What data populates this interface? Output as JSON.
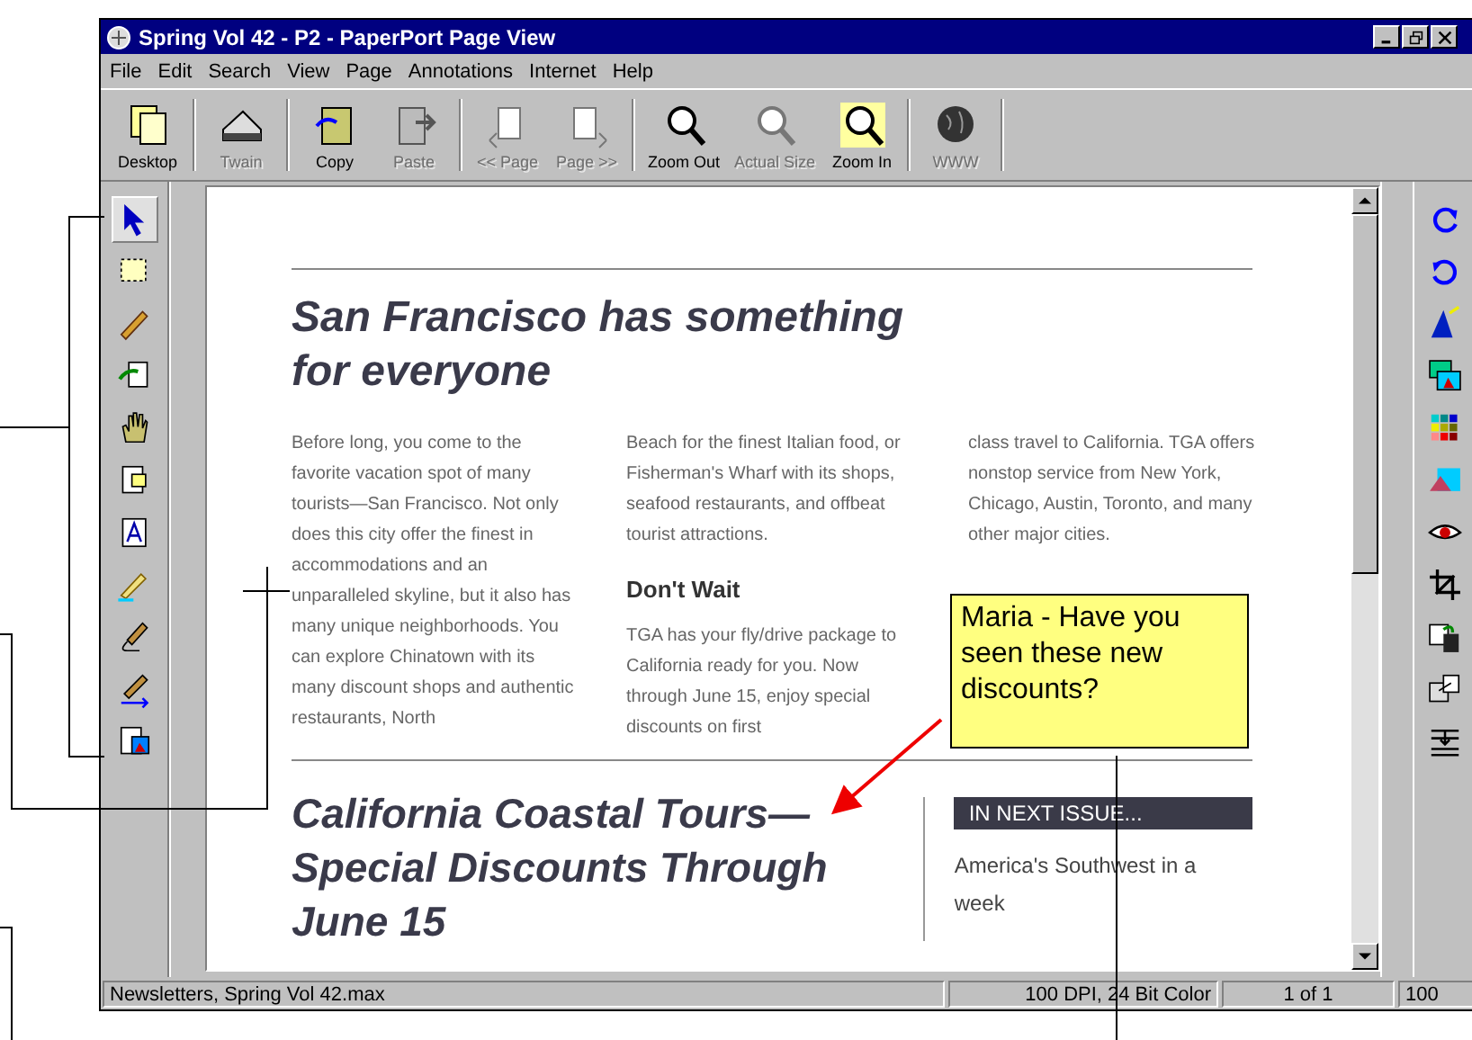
{
  "window": {
    "title": "Spring Vol 42 - P2 - PaperPort Page View"
  },
  "menu": [
    "File",
    "Edit",
    "Search",
    "View",
    "Page",
    "Annotations",
    "Internet",
    "Help"
  ],
  "toolbar": [
    [
      {
        "label": "Desktop",
        "disabled": false
      }
    ],
    [
      {
        "label": "Twain",
        "disabled": true
      }
    ],
    [
      {
        "label": "Copy",
        "disabled": false
      },
      {
        "label": "Paste",
        "disabled": true
      }
    ],
    [
      {
        "label": "<< Page",
        "disabled": true
      },
      {
        "label": "Page >>",
        "disabled": true
      }
    ],
    [
      {
        "label": "Zoom Out",
        "disabled": false
      },
      {
        "label": "Actual Size",
        "disabled": true
      },
      {
        "label": "Zoom In",
        "disabled": false
      }
    ],
    [
      {
        "label": "WWW",
        "disabled": true
      }
    ]
  ],
  "left_tools": [
    {
      "selected": true
    },
    {
      "selected": false
    },
    {
      "selected": false
    },
    {
      "selected": false
    },
    {
      "selected": false
    },
    {
      "selected": false
    },
    {
      "selected": false
    },
    {
      "selected": false
    },
    {
      "selected": false
    },
    {
      "selected": false
    },
    {
      "selected": false
    }
  ],
  "document": {
    "heading": "San Francisco has something for everyone",
    "columns": [
      "Before long, you come to the favorite vacation spot of many tourists—San Francisco. Not only does this city offer the finest in accommodations and an unparalleled skyline, but it also has many unique neighborhoods. You can explore Chinatown with its many discount shops and authentic restaurants, North",
      "Beach for the finest Italian food, or Fisherman's Wharf with its shops, seafood restaurants, and offbeat tourist attractions."
    ],
    "subheading": "Don't Wait",
    "subtext": "TGA has your fly/drive package to California ready for you. Now through June 15, enjoy special discounts on first",
    "column_3": "class travel to California. TGA offers nonstop service from New York, Chicago, Austin, Toronto, and many other major cities.",
    "heading_2": "California Coastal Tours—Special Discounts Through June 15",
    "sidebar_title": "IN NEXT ISSUE...",
    "sidebar_text": "America's Southwest in a week"
  },
  "note": {
    "text": "Maria - Have you seen these new discounts?"
  },
  "status_bar": [
    "Newsletters, Spring Vol 42.max",
    "100 DPI, 24 Bit Color",
    "1 of 1",
    "100"
  ]
}
